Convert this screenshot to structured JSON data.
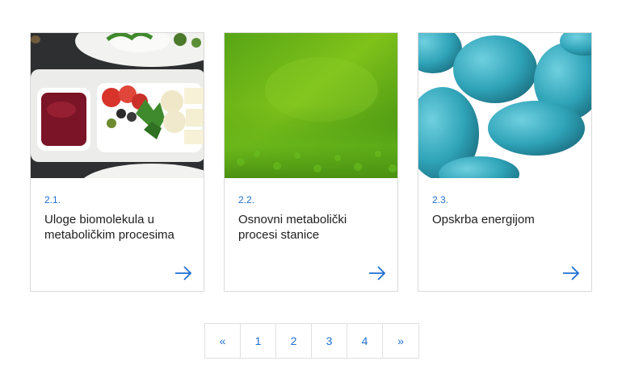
{
  "cards": [
    {
      "number": "2.1.",
      "title": "Uloge biomolekula u metaboličkim procesima",
      "image": "food-platter-photo",
      "arrow_icon": "arrow-right-icon"
    },
    {
      "number": "2.2.",
      "title": "Osnovni metabolički procesi stanice",
      "image": "green-moss-photo",
      "arrow_icon": "arrow-right-icon"
    },
    {
      "number": "2.3.",
      "title": "Opskrba energijom",
      "image": "teal-cells-render",
      "arrow_icon": "arrow-right-icon"
    }
  ],
  "pagination": {
    "first": "«",
    "pages": [
      "1",
      "2",
      "3",
      "4"
    ],
    "last": "»"
  },
  "colors": {
    "accent": "#1f6fd1",
    "border": "#d9d9d9",
    "text": "#1d1d1d"
  }
}
